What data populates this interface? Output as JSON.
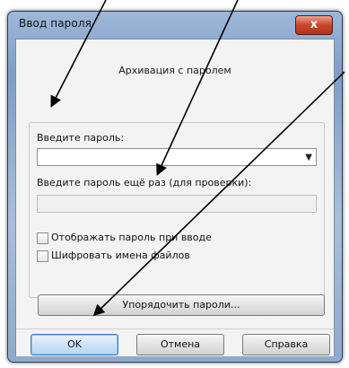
{
  "window": {
    "title": "Ввод пароля",
    "close_glyph": "x"
  },
  "dialog": {
    "subtitle": "Архивация с паролем",
    "password_label": "Введите пароль:",
    "password_value": "",
    "confirm_label": "Введите пароль ещё раз (для проверки):",
    "confirm_value": "",
    "show_password_label": "Отображать пароль при вводе",
    "show_password_checked": false,
    "encrypt_names_label": "Шифровать имена файлов",
    "encrypt_names_checked": false,
    "organize_button": "Упорядочить пароли..."
  },
  "buttons": {
    "ok": "OK",
    "cancel": "Отмена",
    "help": "Справка"
  },
  "colors": {
    "arrow": "#000000",
    "close_button": "#c9452b"
  }
}
